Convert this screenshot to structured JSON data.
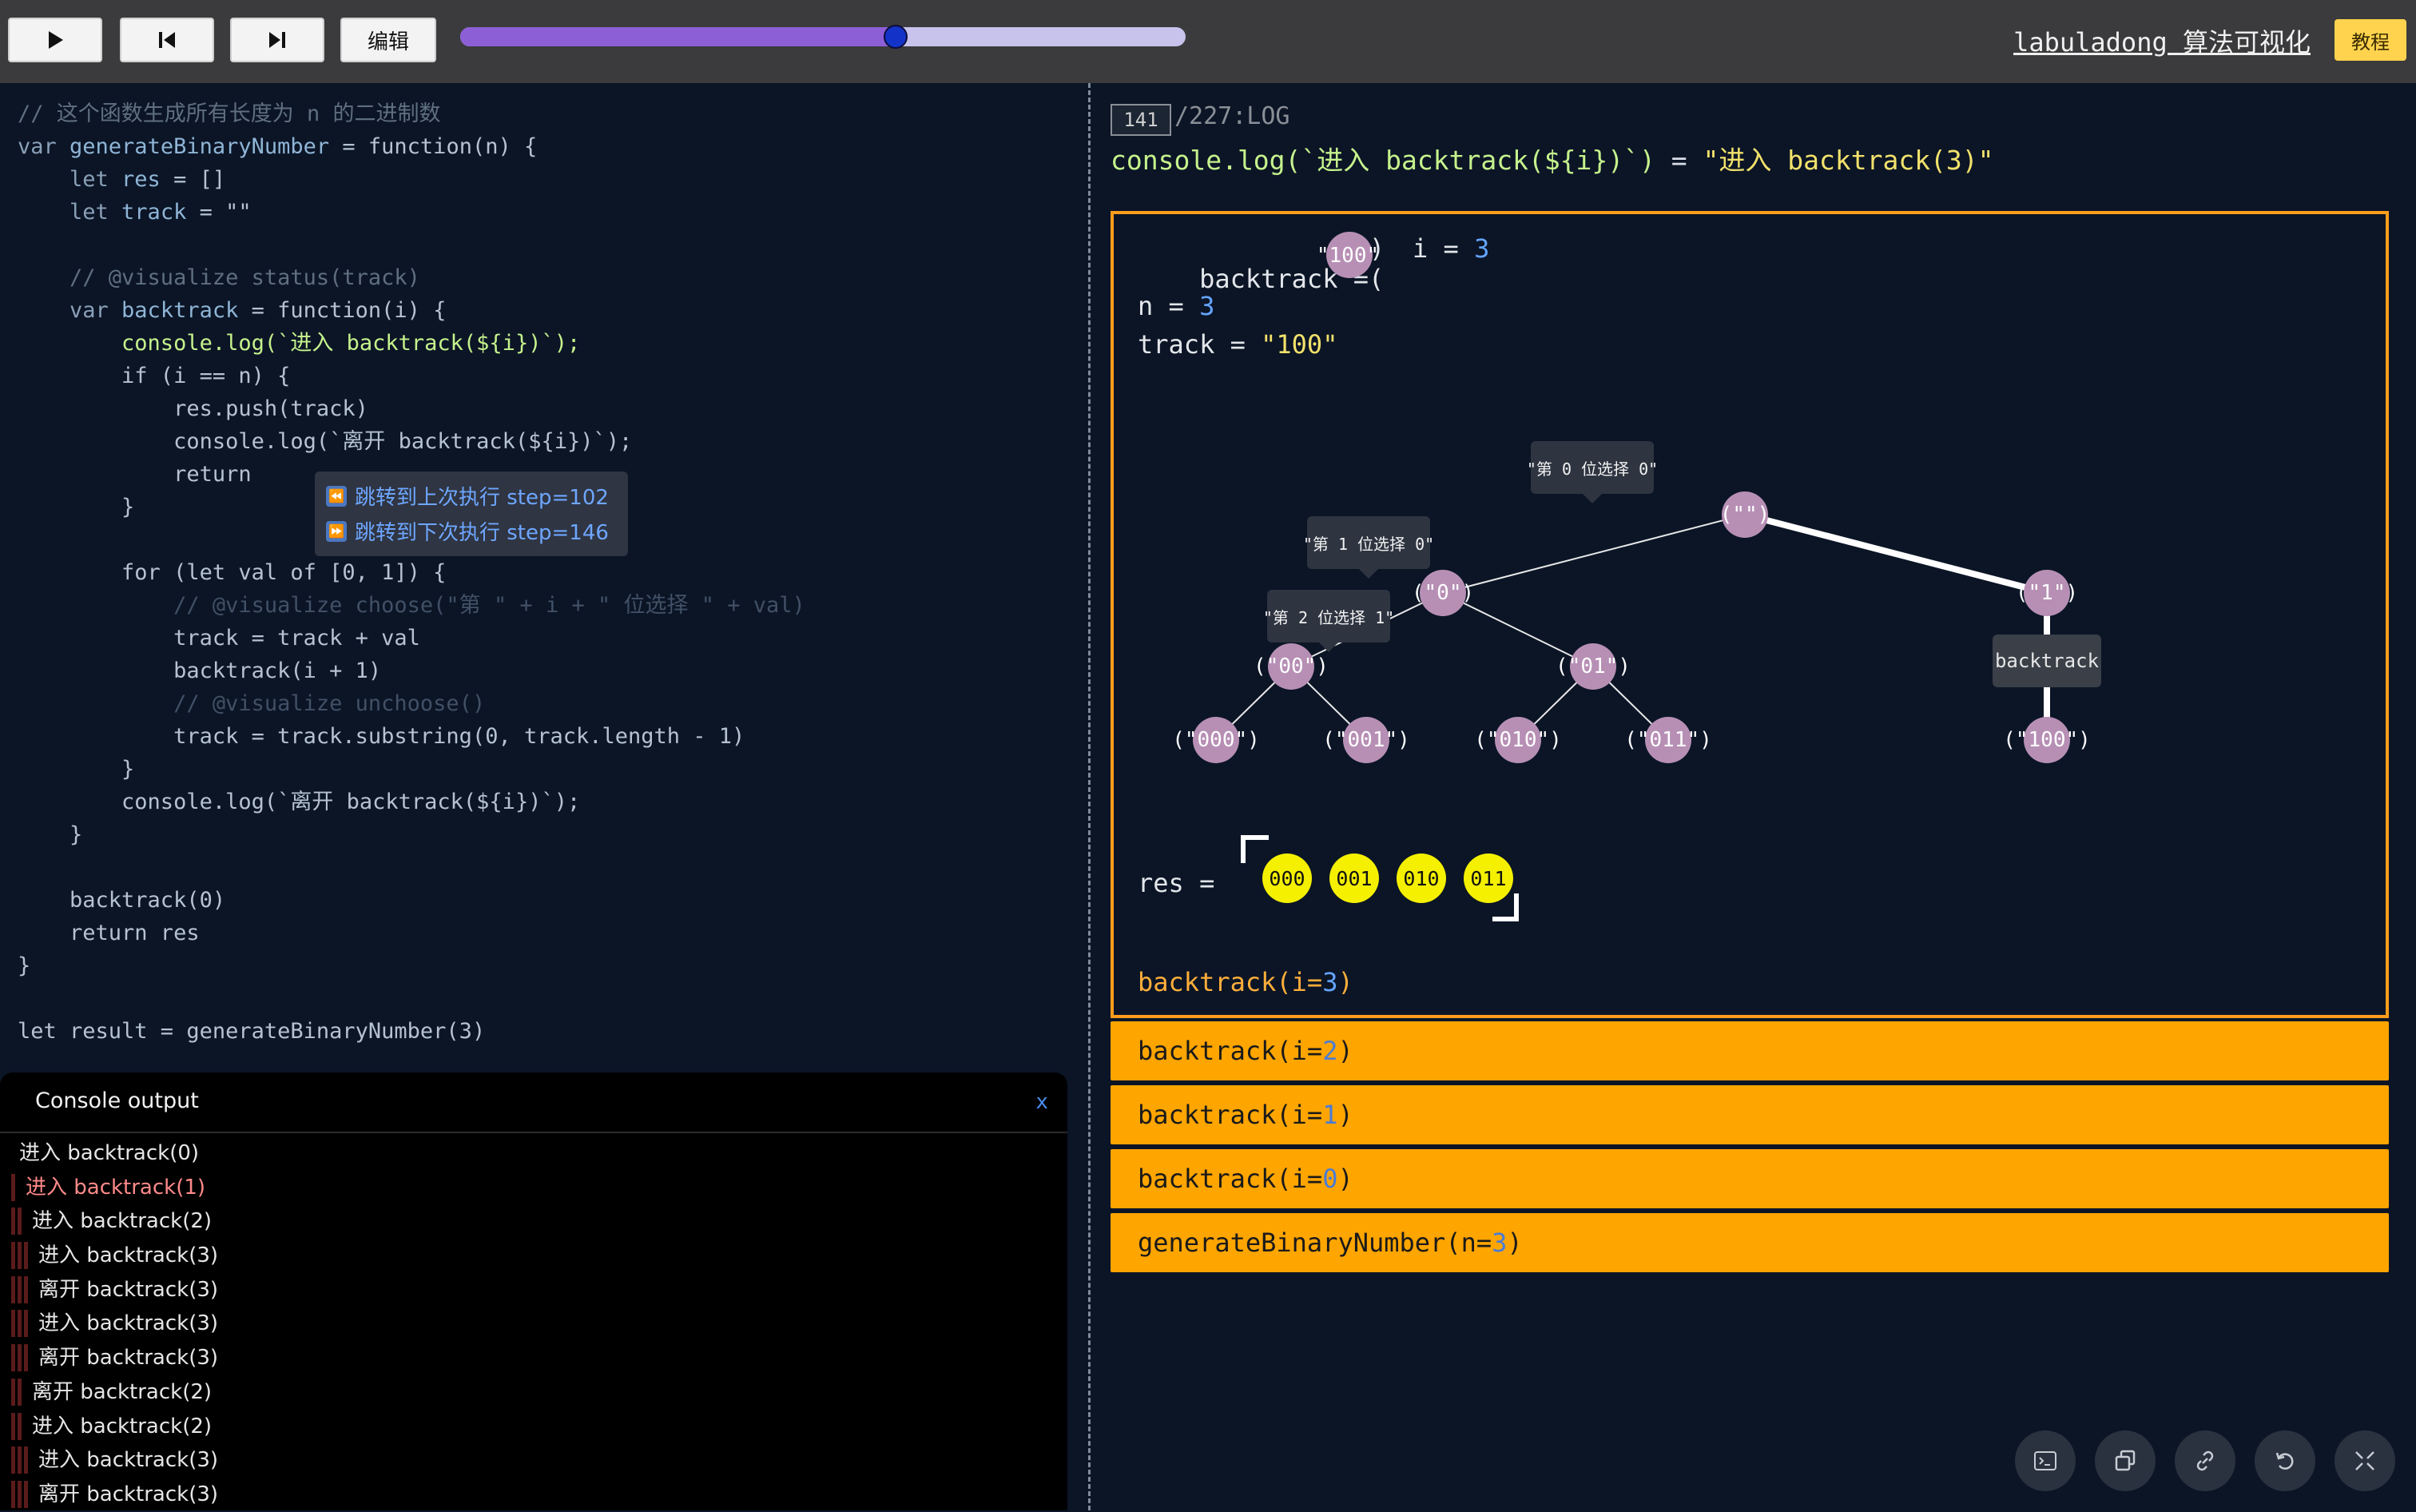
{
  "toolbar": {
    "play_icon": "play-icon",
    "prev_icon": "step-back-icon",
    "next_icon": "step-forward-icon",
    "edit_label": "编辑",
    "progress_value": 0.6,
    "site_title": "labuladong 算法可视化",
    "tutorial_label": "教程"
  },
  "code": {
    "lines": [
      [
        {
          "t": "// 这个函数生成所有长度为 n 的二进制数",
          "c": "comment"
        }
      ],
      [
        {
          "t": "var ",
          "c": "kw"
        },
        {
          "t": "generateBinaryNumber",
          "c": "var"
        },
        {
          "t": " = function(n) {",
          "c": "plain"
        }
      ],
      [
        {
          "t": "    let ",
          "c": "kw"
        },
        {
          "t": "res",
          "c": "var"
        },
        {
          "t": " = []",
          "c": "plain"
        }
      ],
      [
        {
          "t": "    let ",
          "c": "kw"
        },
        {
          "t": "track",
          "c": "var"
        },
        {
          "t": " = \"\"",
          "c": "plain"
        }
      ],
      [
        {
          "t": "",
          "c": "plain"
        }
      ],
      [
        {
          "t": "    // @visualize status(track)",
          "c": "comment"
        }
      ],
      [
        {
          "t": "    var ",
          "c": "kw"
        },
        {
          "t": "backtrack",
          "c": "var"
        },
        {
          "t": " = function(i) {",
          "c": "plain"
        }
      ],
      [
        {
          "t": "        console.log(`进入 backtrack(${i})`);",
          "c": "hl"
        }
      ],
      [
        {
          "t": "        if (i == n) {",
          "c": "plain"
        }
      ],
      [
        {
          "t": "            res.push(track)",
          "c": "plain"
        }
      ],
      [
        {
          "t": "            console.log(`离开 backtrack(${i})`);",
          "c": "plain"
        }
      ],
      [
        {
          "t": "            return",
          "c": "plain"
        }
      ],
      [
        {
          "t": "        }",
          "c": "plain"
        }
      ],
      [
        {
          "t": "",
          "c": "plain"
        }
      ],
      [
        {
          "t": "        for (let val of [0, 1]) {",
          "c": "plain"
        }
      ],
      [
        {
          "t": "            // @visualize choose(\"第 \" + i + \" 位选择 \" + val)",
          "c": "dim"
        }
      ],
      [
        {
          "t": "            track = track + val",
          "c": "plain"
        }
      ],
      [
        {
          "t": "            backtrack(i + 1)",
          "c": "plain"
        }
      ],
      [
        {
          "t": "            // @visualize unchoose()",
          "c": "dim"
        }
      ],
      [
        {
          "t": "            track = track.substring(0, track.length - 1)",
          "c": "plain"
        }
      ],
      [
        {
          "t": "        }",
          "c": "plain"
        }
      ],
      [
        {
          "t": "        console.log(`离开 backtrack(${i})`);",
          "c": "plain"
        }
      ],
      [
        {
          "t": "    }",
          "c": "plain"
        }
      ],
      [
        {
          "t": "",
          "c": "plain"
        }
      ],
      [
        {
          "t": "    backtrack(0)",
          "c": "plain"
        }
      ],
      [
        {
          "t": "    return res",
          "c": "plain"
        }
      ],
      [
        {
          "t": "}",
          "c": "plain"
        }
      ],
      [
        {
          "t": "",
          "c": "plain"
        }
      ],
      [
        {
          "t": "let result = generateBinaryNumber(3)",
          "c": "plain"
        }
      ]
    ]
  },
  "tooltip": {
    "prev": "跳转到上次执行 step=102",
    "next": "跳转到下次执行 step=146",
    "prev_icon": "rewind-icon",
    "next_icon": "fast-forward-icon"
  },
  "console": {
    "title": "Console output",
    "close": "x",
    "lines": [
      {
        "text": "进入 backtrack(0)",
        "depth": 0
      },
      {
        "text": "进入 backtrack(1)",
        "depth": 1
      },
      {
        "text": "进入 backtrack(2)",
        "depth": 2
      },
      {
        "text": "进入 backtrack(3)",
        "depth": 3
      },
      {
        "text": "离开 backtrack(3)",
        "depth": 3
      },
      {
        "text": "进入 backtrack(3)",
        "depth": 3
      },
      {
        "text": "离开 backtrack(3)",
        "depth": 3
      },
      {
        "text": "离开 backtrack(2)",
        "depth": 2
      },
      {
        "text": "进入 backtrack(2)",
        "depth": 2
      },
      {
        "text": "进入 backtrack(3)",
        "depth": 3
      },
      {
        "text": "离开 backtrack(3)",
        "depth": 3
      }
    ]
  },
  "step": {
    "current": "141",
    "total": "/227:LOG",
    "log_expr": "console.log(`进入 backtrack(${i})`)",
    "log_eq": " = ",
    "log_value": "\"进入 backtrack(3)\""
  },
  "frame": {
    "backtrack_label": "backtrack =",
    "backtrack_paren_open": "(",
    "backtrack_value": "\"100\"",
    "backtrack_paren_close": ")",
    "i_label": "i = ",
    "i_value": "3",
    "n_label": "n = ",
    "n_value": "3",
    "track_label": "track = ",
    "track_value": "\"100\"",
    "res_label": "res =",
    "res_items": [
      "000",
      "001",
      "010",
      "011"
    ],
    "label_name": "backtrack(i=",
    "label_value": "3",
    "label_close": ")"
  },
  "tree": {
    "nodes": [
      {
        "label": "(\"\")"
      },
      {
        "label": "(\"0\")"
      },
      {
        "label": "(\"1\")"
      },
      {
        "label": "(\"00\")"
      },
      {
        "label": "(\"01\")"
      },
      {
        "label": "(\"000\")"
      },
      {
        "label": "(\"001\")"
      },
      {
        "label": "(\"010\")"
      },
      {
        "label": "(\"011\")"
      },
      {
        "label": "(\"100\")"
      }
    ],
    "choices": [
      "\"第 0 位选择 0\"",
      "\"第 1 位选择 0\"",
      "\"第 2 位选择 1\""
    ],
    "backtrack_tag": "backtrack"
  },
  "stack": [
    {
      "name": "backtrack(i=",
      "value": "2",
      "close": ")"
    },
    {
      "name": "backtrack(i=",
      "value": "1",
      "close": ")"
    },
    {
      "name": "backtrack(i=",
      "value": "0",
      "close": ")"
    },
    {
      "name": "generateBinaryNumber(n=",
      "value": "3",
      "close": ")"
    }
  ],
  "fabs": [
    "terminal-icon",
    "copy-icon",
    "link-icon",
    "reset-icon",
    "collapse-icon"
  ]
}
